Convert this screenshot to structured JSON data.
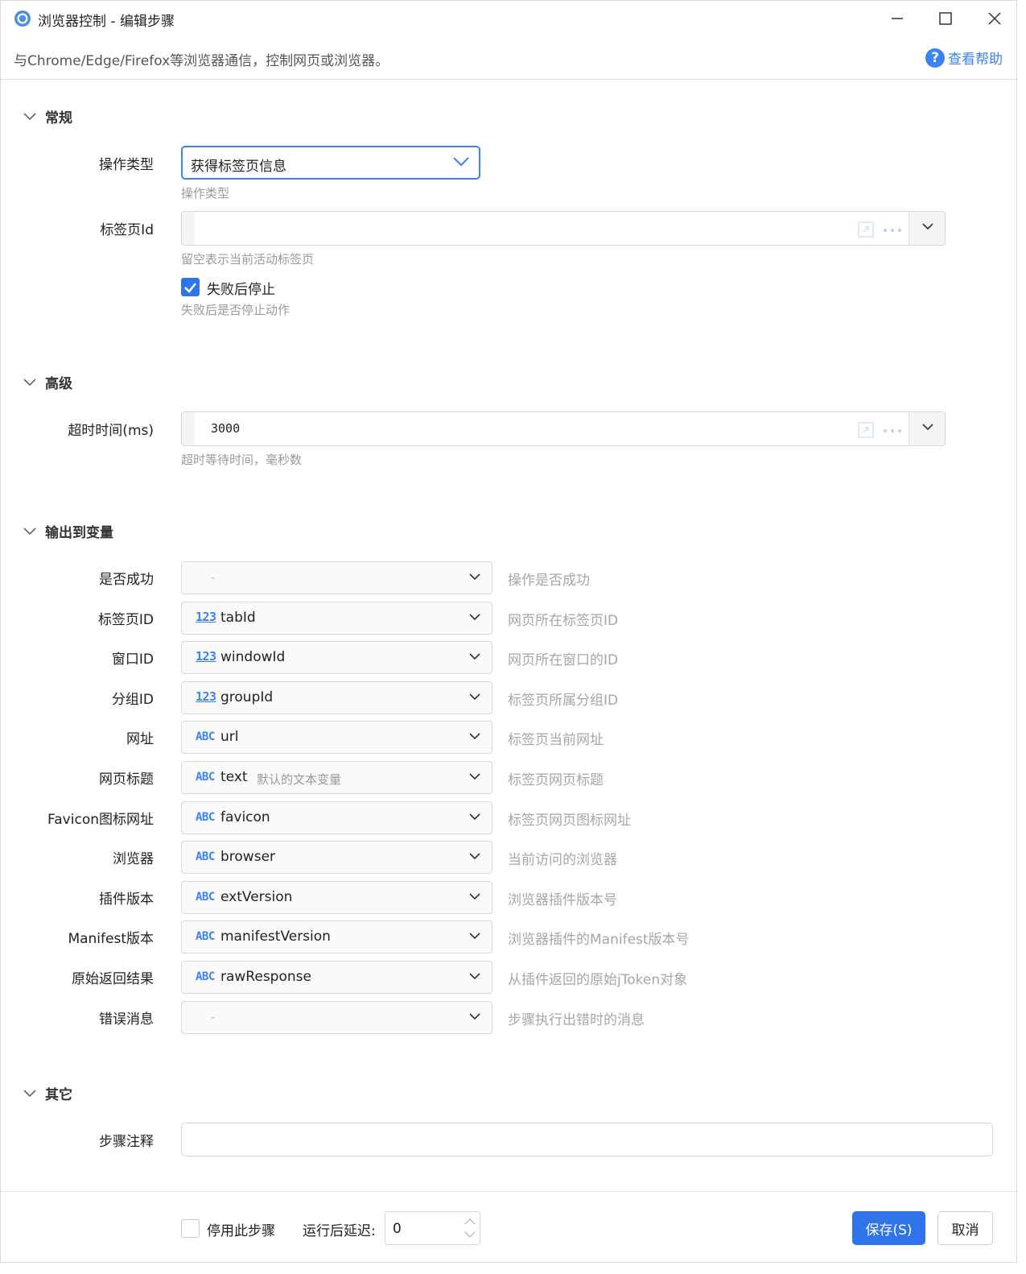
{
  "window": {
    "title": "浏览器控制  -  编辑步骤",
    "description": "与Chrome/Edge/Firefox等浏览器通信，控制网页或浏览器。",
    "help_label": "查看帮助"
  },
  "sections": {
    "general": {
      "title": "常规",
      "op_type": {
        "label": "操作类型",
        "value": "获得标签页信息",
        "hint": "操作类型"
      },
      "tab_id": {
        "label": "标签页Id",
        "value": "",
        "hint": "留空表示当前活动标签页"
      },
      "stop_on_fail": {
        "label": "失败后停止",
        "checked": true,
        "hint": "失败后是否停止动作"
      }
    },
    "advanced": {
      "title": "高级",
      "timeout": {
        "label": "超时时间(ms)",
        "value": "3000",
        "hint": "超时等待时间，毫秒数"
      }
    },
    "output": {
      "title": "输出到变量",
      "rows": [
        {
          "label": "是否成功",
          "type": "",
          "name": "-",
          "sub": "",
          "desc": "操作是否成功"
        },
        {
          "label": "标签页ID",
          "type": "123",
          "name": "tabId",
          "sub": "",
          "desc": "网页所在标签页ID"
        },
        {
          "label": "窗口ID",
          "type": "123",
          "name": "windowId",
          "sub": "",
          "desc": "网页所在窗口的ID"
        },
        {
          "label": "分组ID",
          "type": "123",
          "name": "groupId",
          "sub": "",
          "desc": "标签页所属分组ID"
        },
        {
          "label": "网址",
          "type": "ABC",
          "name": "url",
          "sub": "",
          "desc": "标签页当前网址"
        },
        {
          "label": "网页标题",
          "type": "ABC",
          "name": "text",
          "sub": "默认的文本变量",
          "desc": "标签页网页标题"
        },
        {
          "label": "Favicon图标网址",
          "type": "ABC",
          "name": "favicon",
          "sub": "",
          "desc": "标签页网页图标网址"
        },
        {
          "label": "浏览器",
          "type": "ABC",
          "name": "browser",
          "sub": "",
          "desc": "当前访问的浏览器"
        },
        {
          "label": "插件版本",
          "type": "ABC",
          "name": "extVersion",
          "sub": "",
          "desc": "浏览器插件版本号"
        },
        {
          "label": "Manifest版本",
          "type": "ABC",
          "name": "manifestVersion",
          "sub": "",
          "desc": "浏览器插件的Manifest版本号"
        },
        {
          "label": "原始返回结果",
          "type": "ABC",
          "name": "rawResponse",
          "sub": "",
          "desc": "从插件返回的原始jToken对象"
        },
        {
          "label": "错误消息",
          "type": "",
          "name": "-",
          "sub": "",
          "desc": "步骤执行出错时的消息"
        }
      ]
    },
    "other": {
      "title": "其它",
      "note": {
        "label": "步骤注释",
        "value": ""
      }
    }
  },
  "footer": {
    "disable_label": "停用此步骤",
    "disable_checked": false,
    "delay_label": "运行后延迟:",
    "delay_value": "0",
    "save_label": "保存(S)",
    "cancel_label": "取消"
  },
  "colors": {
    "accent": "#2f74e8",
    "link": "#3b82f6"
  }
}
